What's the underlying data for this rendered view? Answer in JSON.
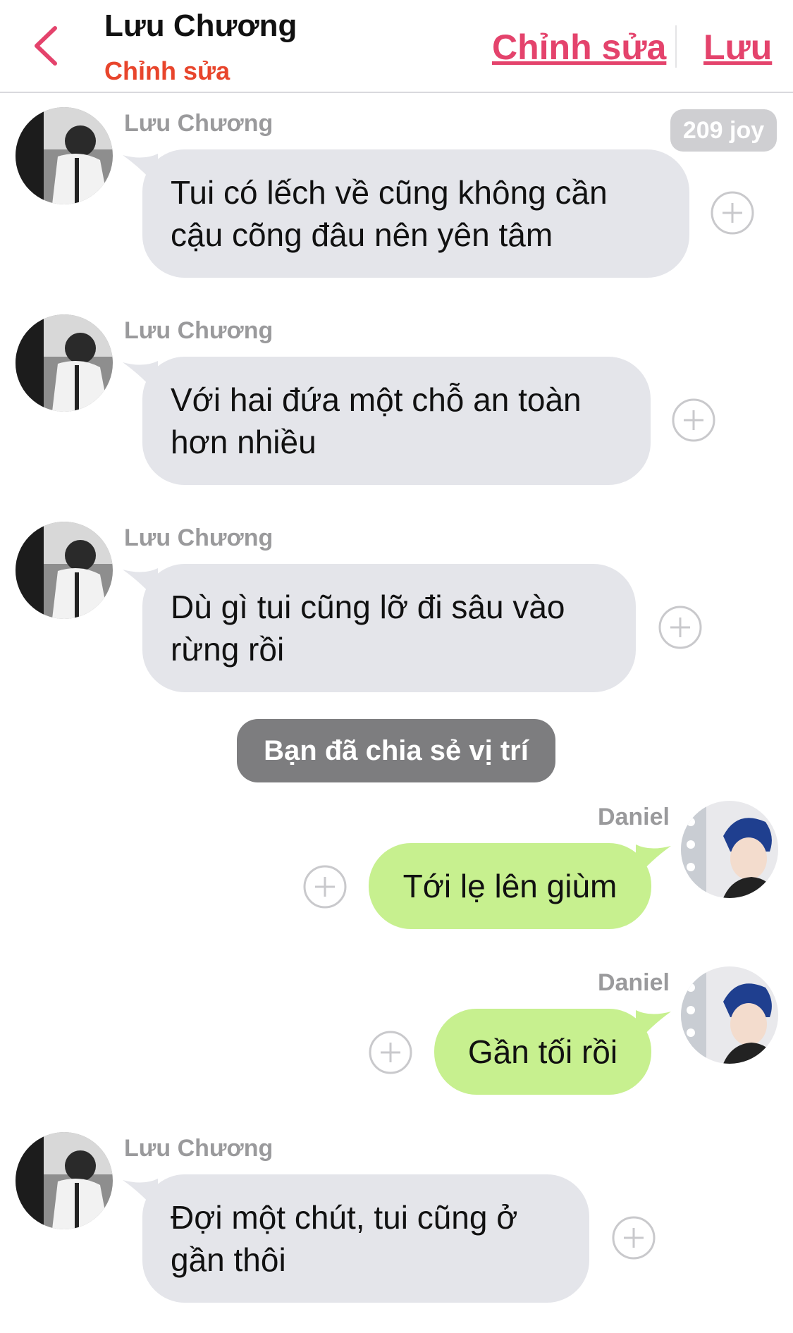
{
  "header": {
    "title": "Lưu Chương",
    "subtitle": "Chỉnh sửa",
    "edit_label": "Chỉnh sửa",
    "save_label": "Lưu",
    "back_icon": "chevron-left-icon",
    "accent_color": "#e4436c"
  },
  "joy_badge": "209 joy",
  "messages": [
    {
      "sender": "Lưu Chương",
      "side": "in",
      "lines": [
        "Tui có lếch về cũng không cần",
        "cậu cõng đâu nên yên tâm"
      ]
    },
    {
      "sender": "Lưu Chương",
      "side": "in",
      "lines": [
        "Với hai đứa một chỗ an toàn",
        "hơn nhiều"
      ]
    },
    {
      "sender": "Lưu Chương",
      "side": "in",
      "lines": [
        "Dù gì tui cũng lỡ đi sâu vào",
        "rừng rồi"
      ]
    },
    {
      "sender": "Daniel",
      "side": "out",
      "lines": [
        "Tới lẹ lên giùm"
      ]
    },
    {
      "sender": "Daniel",
      "side": "out",
      "lines": [
        "Gần tối rồi"
      ]
    },
    {
      "sender": "Lưu Chương",
      "side": "in",
      "lines": [
        "Đợi một chút, tui cũng ở",
        "gần thôi"
      ]
    }
  ],
  "system_message": "Bạn đã chia sẻ vị trí",
  "colors": {
    "incoming_bubble": "#e4e5ea",
    "outgoing_bubble": "#c7f08f",
    "system_pill": "#7d7d7f",
    "subtitle": "#e8452c"
  }
}
